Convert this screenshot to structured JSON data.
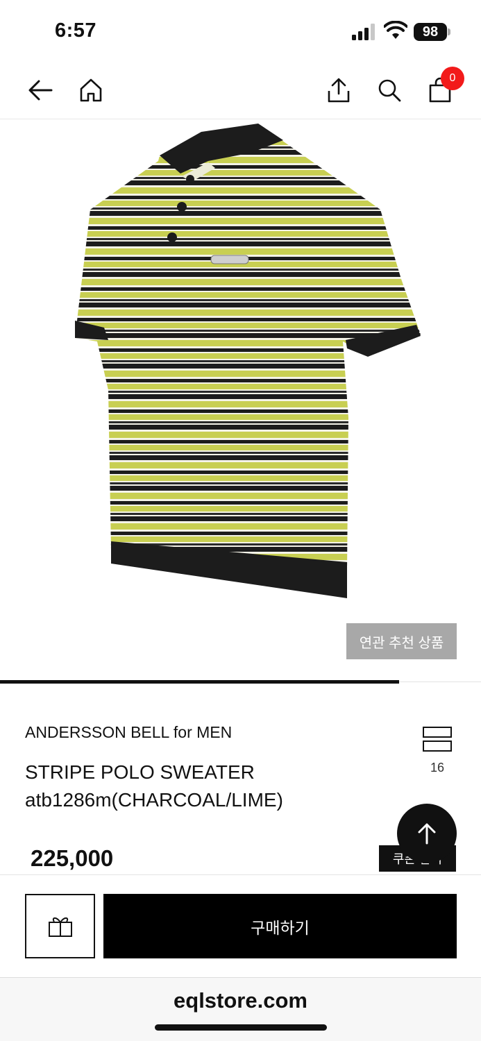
{
  "status_bar": {
    "time": "6:57",
    "battery": "98"
  },
  "nav": {
    "icons": [
      "back-arrow-icon",
      "home-icon",
      "share-icon",
      "search-icon",
      "shopping-bag-icon"
    ],
    "cart_count": "0"
  },
  "product": {
    "related_label": "연관 추천 상품",
    "image_progress": 0.83,
    "brand": "ANDERSSON BELL for MEN",
    "title": "STRIPE POLO SWEATER atb1286m(CHARCOAL/LIME)",
    "view_count": "16",
    "price": "225,000",
    "coupon_label": "쿠폰 받기",
    "colors": {
      "charcoal": "#1c1c1c",
      "lime": "#c8cf52",
      "white": "#f4f3e8"
    }
  },
  "actions": {
    "buy_label": "구매하기"
  },
  "browser": {
    "url": "eqlstore.com"
  }
}
